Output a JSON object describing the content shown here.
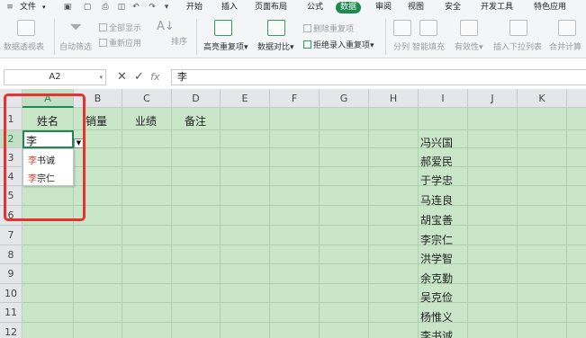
{
  "menu": {
    "file": "文件",
    "tabs": [
      "开始",
      "插入",
      "页面布局",
      "公式",
      "数据",
      "审阅",
      "视图",
      "安全",
      "开发工具",
      "特色应用"
    ],
    "active_tab": "数据"
  },
  "ribbon": {
    "pivot": "数据透视表",
    "autofilter": "自动筛选",
    "show_all": "全部显示",
    "reapply": "重新应用",
    "sort": "排序",
    "highlight_dup": "高亮重复项",
    "compare": "数据对比",
    "remove_dup": "删除重复项",
    "reject_dup": "拒绝录入重复项",
    "split": "分列",
    "smart_fill": "智能填充",
    "validity": "有效性",
    "insert_dropdown": "插入下拉列表",
    "consolidate": "合并计算"
  },
  "formula_bar": {
    "name_box": "A2",
    "content": "李"
  },
  "grid": {
    "columns": [
      "A",
      "B",
      "C",
      "D",
      "E",
      "F",
      "G",
      "H",
      "I",
      "J",
      "K"
    ],
    "rows": [
      "1",
      "2",
      "3",
      "4",
      "5",
      "6",
      "7",
      "8",
      "9",
      "10",
      "11",
      "12"
    ],
    "headers": [
      "姓名",
      "销量",
      "业绩",
      "备注"
    ],
    "active_cell_value": "李",
    "dropdown": [
      {
        "highlight": "李",
        "rest": "书诚"
      },
      {
        "highlight": "李",
        "rest": "宗仁"
      }
    ],
    "column_i": [
      "冯兴国",
      "郝爱民",
      "于学忠",
      "马连良",
      "胡宝善",
      "李宗仁",
      "洪学智",
      "余克勤",
      "吴克俭",
      "杨惟义",
      "李书诚"
    ]
  },
  "colors": {
    "accent": "#1c8a4e",
    "sheet_bg": "#c9e6c9",
    "annotation_red": "#e8322e",
    "match_highlight": "#d63b2f"
  }
}
